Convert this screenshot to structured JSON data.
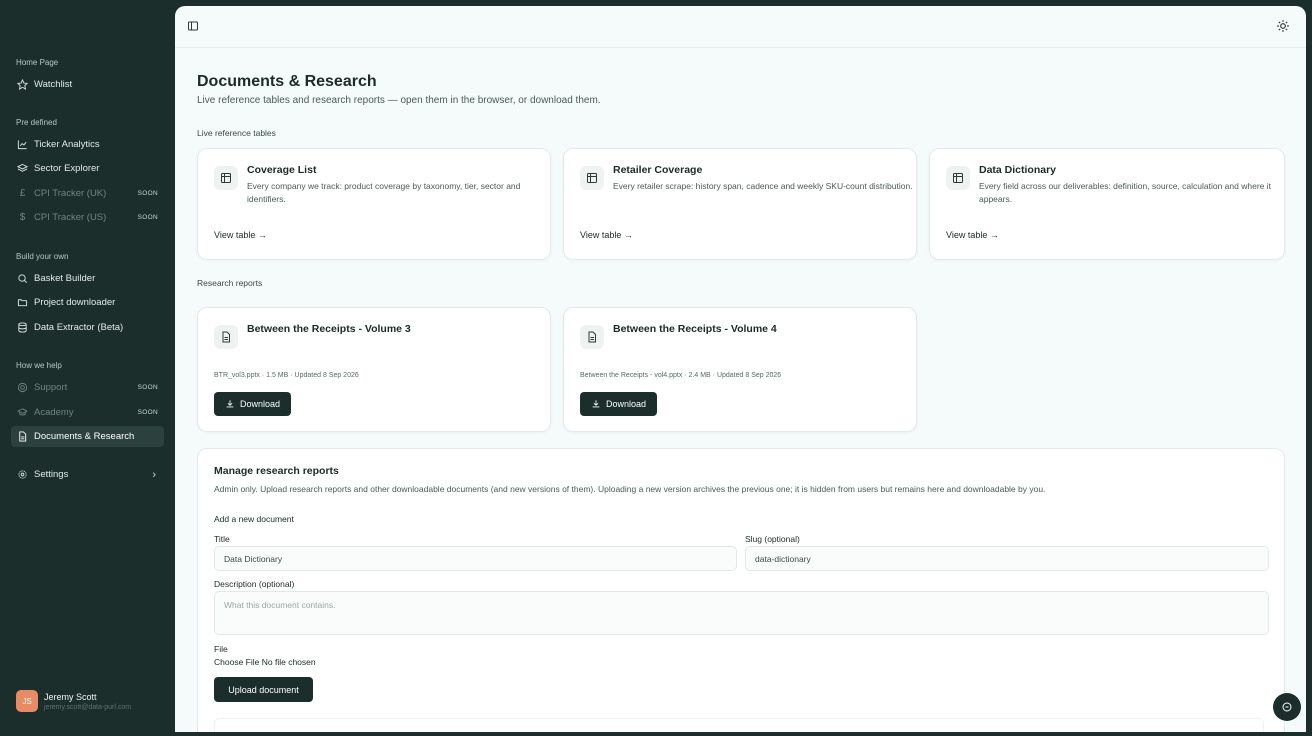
{
  "sidebar": {
    "sections": {
      "home": "Home Page",
      "predefined": "Pre defined",
      "build": "Build your own",
      "help": "How we help"
    },
    "items": {
      "watchlist": "Watchlist",
      "ticker_analytics": "Ticker Analytics",
      "sector_explorer": "Sector Explorer",
      "cpi_uk": "CPI Tracker (UK)",
      "cpi_us": "CPI Tracker (US)",
      "basket_builder": "Basket Builder",
      "project_downloader": "Project downloader",
      "data_extractor": "Data Extractor (Beta)",
      "support": "Support",
      "academy": "Academy",
      "documents": "Documents & Research",
      "settings": "Settings"
    },
    "soon_badge": "SOON",
    "user": {
      "initials": "JS",
      "name": "Jeremy Scott",
      "email": "jeremy.scott@data-purl.com"
    }
  },
  "page": {
    "title": "Documents & Research",
    "subtitle": "Live reference tables and research reports — open them in the browser, or download them.",
    "live_tables_label": "Live reference tables",
    "research_label": "Research reports"
  },
  "tables": [
    {
      "title": "Coverage List",
      "desc": "Every company we track: product coverage by taxonomy, tier, sector and identifiers.",
      "link": "View table"
    },
    {
      "title": "Retailer Coverage",
      "desc": "Every retailer scrape: history span, cadence and weekly SKU-count distribution.",
      "link": "View table"
    },
    {
      "title": "Data Dictionary",
      "desc": "Every field across our deliverables: definition, source, calculation and where it appears.",
      "link": "View table"
    }
  ],
  "reports": [
    {
      "title": "Between the Receipts - Volume 3",
      "meta": "BTR_vol3.pptx · 1.5 MB · Updated 8 Sep 2026",
      "button": "Download"
    },
    {
      "title": "Between the Receipts - Volume 4",
      "meta": "Between the Receipts - vol4.pptx · 2.4 MB · Updated 8 Sep 2026",
      "button": "Download"
    }
  ],
  "manage": {
    "title": "Manage research reports",
    "desc": "Admin only. Upload research reports and other downloadable documents (and new versions of them). Uploading a new version archives the previous one; it is hidden from users but remains here and downloadable by you.",
    "add_label": "Add a new document",
    "title_label": "Title",
    "title_value": "Data Dictionary",
    "slug_label": "Slug (optional)",
    "slug_value": "data-dictionary",
    "desc_label": "Description (optional)",
    "desc_placeholder": "What this document contains.",
    "file_label": "File",
    "file_choose": "Choose File",
    "file_none": "No file chosen",
    "upload_button": "Upload document"
  }
}
